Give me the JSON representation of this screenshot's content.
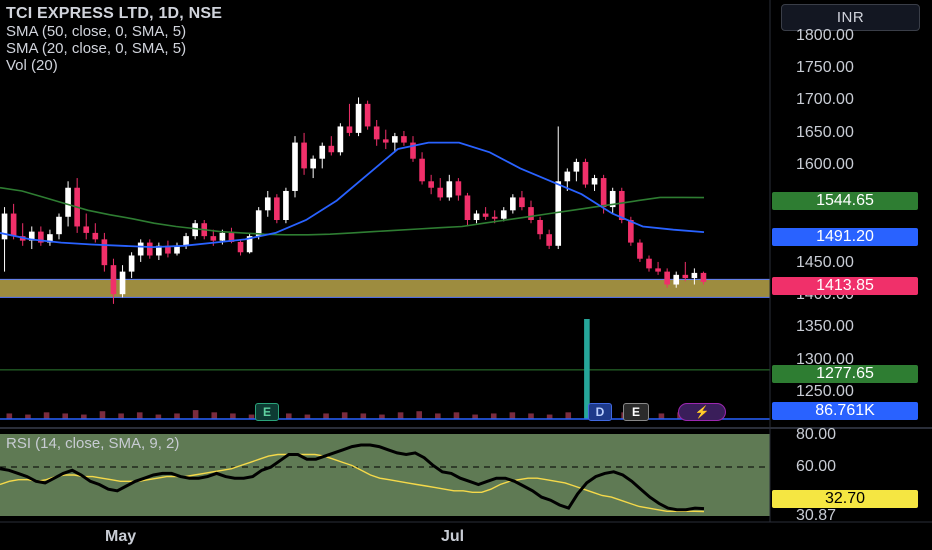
{
  "header": {
    "title": "TCI EXPRESS LTD, 1D, NSE",
    "indicator1": "SMA (50, close, 0, SMA, 5)",
    "indicator2": "SMA (20, close, 0, SMA, 5)",
    "indicator3": "Vol (20)"
  },
  "currency_button": "INR",
  "price_axis_ticks": [
    "1800.00",
    "1750.00",
    "1700.00",
    "1650.00",
    "1600.00",
    "1450.00",
    "1400.00",
    "1350.00",
    "1300.00",
    "1250.00"
  ],
  "badges": {
    "sma50": "1544.65",
    "sma20": "1491.20",
    "last_price": "1413.85",
    "hline": "1277.65",
    "volume": "86.761K"
  },
  "rsi": {
    "label": "RSI (14, close, SMA, 9, 2)",
    "ticks": [
      "80.00",
      "60.00"
    ],
    "rsi_value": "32.70",
    "rsi_ma_value": "30.87"
  },
  "time_axis": [
    "May",
    "Jul"
  ],
  "events": {
    "earnings1": "E",
    "dividend": "D",
    "earnings2": "E",
    "flash": "⚡"
  },
  "colors": {
    "up": "#ffffff",
    "down": "#f0306a",
    "sma50": "#2e7d32",
    "sma20": "#2962ff",
    "support_zone": "#b9a44a",
    "rsi_bg": "#5f7a54",
    "rsi_ma": "#f5d94a"
  },
  "chart_data": {
    "type": "candlestick",
    "ylim": [
      1200,
      1820
    ],
    "support_zone": [
      1390,
      1418
    ],
    "horizontal_line": 1277.65,
    "candles": [
      {
        "o": 1480,
        "h": 1530,
        "l": 1430,
        "c": 1520
      },
      {
        "o": 1520,
        "h": 1535,
        "l": 1480,
        "c": 1485
      },
      {
        "o": 1485,
        "h": 1505,
        "l": 1470,
        "c": 1478
      },
      {
        "o": 1478,
        "h": 1500,
        "l": 1465,
        "c": 1492
      },
      {
        "o": 1492,
        "h": 1500,
        "l": 1470,
        "c": 1475
      },
      {
        "o": 1475,
        "h": 1495,
        "l": 1470,
        "c": 1488
      },
      {
        "o": 1488,
        "h": 1520,
        "l": 1480,
        "c": 1515
      },
      {
        "o": 1515,
        "h": 1570,
        "l": 1500,
        "c": 1560
      },
      {
        "o": 1560,
        "h": 1575,
        "l": 1490,
        "c": 1500
      },
      {
        "o": 1500,
        "h": 1520,
        "l": 1480,
        "c": 1490
      },
      {
        "o": 1490,
        "h": 1505,
        "l": 1475,
        "c": 1480
      },
      {
        "o": 1480,
        "h": 1490,
        "l": 1430,
        "c": 1440
      },
      {
        "o": 1440,
        "h": 1450,
        "l": 1380,
        "c": 1395
      },
      {
        "o": 1395,
        "h": 1440,
        "l": 1390,
        "c": 1430
      },
      {
        "o": 1430,
        "h": 1460,
        "l": 1420,
        "c": 1455
      },
      {
        "o": 1455,
        "h": 1480,
        "l": 1445,
        "c": 1475
      },
      {
        "o": 1475,
        "h": 1480,
        "l": 1450,
        "c": 1455
      },
      {
        "o": 1455,
        "h": 1475,
        "l": 1448,
        "c": 1470
      },
      {
        "o": 1470,
        "h": 1478,
        "l": 1452,
        "c": 1458
      },
      {
        "o": 1458,
        "h": 1475,
        "l": 1455,
        "c": 1470
      },
      {
        "o": 1470,
        "h": 1490,
        "l": 1465,
        "c": 1485
      },
      {
        "o": 1485,
        "h": 1510,
        "l": 1480,
        "c": 1505
      },
      {
        "o": 1505,
        "h": 1510,
        "l": 1480,
        "c": 1485
      },
      {
        "o": 1485,
        "h": 1495,
        "l": 1470,
        "c": 1478
      },
      {
        "o": 1478,
        "h": 1495,
        "l": 1472,
        "c": 1490
      },
      {
        "o": 1490,
        "h": 1498,
        "l": 1474,
        "c": 1476
      },
      {
        "o": 1476,
        "h": 1480,
        "l": 1455,
        "c": 1460
      },
      {
        "o": 1460,
        "h": 1490,
        "l": 1458,
        "c": 1485
      },
      {
        "o": 1485,
        "h": 1530,
        "l": 1480,
        "c": 1525
      },
      {
        "o": 1525,
        "h": 1555,
        "l": 1515,
        "c": 1545
      },
      {
        "o": 1545,
        "h": 1550,
        "l": 1505,
        "c": 1510
      },
      {
        "o": 1510,
        "h": 1560,
        "l": 1505,
        "c": 1555
      },
      {
        "o": 1555,
        "h": 1640,
        "l": 1545,
        "c": 1630
      },
      {
        "o": 1630,
        "h": 1645,
        "l": 1580,
        "c": 1590
      },
      {
        "o": 1590,
        "h": 1610,
        "l": 1575,
        "c": 1605
      },
      {
        "o": 1605,
        "h": 1630,
        "l": 1590,
        "c": 1625
      },
      {
        "o": 1625,
        "h": 1640,
        "l": 1610,
        "c": 1615
      },
      {
        "o": 1615,
        "h": 1660,
        "l": 1610,
        "c": 1655
      },
      {
        "o": 1655,
        "h": 1690,
        "l": 1640,
        "c": 1645
      },
      {
        "o": 1645,
        "h": 1700,
        "l": 1640,
        "c": 1690
      },
      {
        "o": 1690,
        "h": 1695,
        "l": 1650,
        "c": 1655
      },
      {
        "o": 1655,
        "h": 1665,
        "l": 1625,
        "c": 1635
      },
      {
        "o": 1635,
        "h": 1650,
        "l": 1620,
        "c": 1630
      },
      {
        "o": 1630,
        "h": 1645,
        "l": 1615,
        "c": 1640
      },
      {
        "o": 1640,
        "h": 1648,
        "l": 1625,
        "c": 1630
      },
      {
        "o": 1630,
        "h": 1640,
        "l": 1600,
        "c": 1605
      },
      {
        "o": 1605,
        "h": 1615,
        "l": 1565,
        "c": 1570
      },
      {
        "o": 1570,
        "h": 1580,
        "l": 1550,
        "c": 1560
      },
      {
        "o": 1560,
        "h": 1575,
        "l": 1540,
        "c": 1545
      },
      {
        "o": 1545,
        "h": 1580,
        "l": 1540,
        "c": 1570
      },
      {
        "o": 1570,
        "h": 1575,
        "l": 1540,
        "c": 1548
      },
      {
        "o": 1548,
        "h": 1552,
        "l": 1500,
        "c": 1510
      },
      {
        "o": 1510,
        "h": 1525,
        "l": 1505,
        "c": 1520
      },
      {
        "o": 1520,
        "h": 1530,
        "l": 1510,
        "c": 1515
      },
      {
        "o": 1515,
        "h": 1525,
        "l": 1505,
        "c": 1512
      },
      {
        "o": 1512,
        "h": 1530,
        "l": 1508,
        "c": 1525
      },
      {
        "o": 1525,
        "h": 1550,
        "l": 1520,
        "c": 1545
      },
      {
        "o": 1545,
        "h": 1555,
        "l": 1525,
        "c": 1530
      },
      {
        "o": 1530,
        "h": 1540,
        "l": 1505,
        "c": 1510
      },
      {
        "o": 1510,
        "h": 1515,
        "l": 1480,
        "c": 1488
      },
      {
        "o": 1488,
        "h": 1495,
        "l": 1465,
        "c": 1470
      },
      {
        "o": 1470,
        "h": 1655,
        "l": 1465,
        "c": 1570
      },
      {
        "o": 1570,
        "h": 1590,
        "l": 1555,
        "c": 1585
      },
      {
        "o": 1585,
        "h": 1605,
        "l": 1570,
        "c": 1600
      },
      {
        "o": 1600,
        "h": 1605,
        "l": 1560,
        "c": 1565
      },
      {
        "o": 1565,
        "h": 1580,
        "l": 1555,
        "c": 1575
      },
      {
        "o": 1575,
        "h": 1580,
        "l": 1520,
        "c": 1530
      },
      {
        "o": 1530,
        "h": 1560,
        "l": 1520,
        "c": 1555
      },
      {
        "o": 1555,
        "h": 1560,
        "l": 1505,
        "c": 1510
      },
      {
        "o": 1510,
        "h": 1515,
        "l": 1470,
        "c": 1475
      },
      {
        "o": 1475,
        "h": 1480,
        "l": 1445,
        "c": 1450
      },
      {
        "o": 1450,
        "h": 1455,
        "l": 1430,
        "c": 1435
      },
      {
        "o": 1435,
        "h": 1445,
        "l": 1425,
        "c": 1430
      },
      {
        "o": 1430,
        "h": 1435,
        "l": 1405,
        "c": 1410
      },
      {
        "o": 1410,
        "h": 1430,
        "l": 1405,
        "c": 1425
      },
      {
        "o": 1425,
        "h": 1445,
        "l": 1415,
        "c": 1420
      },
      {
        "o": 1420,
        "h": 1435,
        "l": 1410,
        "c": 1428
      },
      {
        "o": 1428,
        "h": 1430,
        "l": 1410,
        "c": 1414
      }
    ],
    "sma50": [
      1560,
      1555,
      1545,
      1535,
      1525,
      1518,
      1512,
      1505,
      1500,
      1496,
      1492,
      1490,
      1488,
      1487,
      1487,
      1488,
      1490,
      1492,
      1494,
      1496,
      1498,
      1500,
      1505,
      1510,
      1515,
      1520,
      1525,
      1530,
      1535,
      1540,
      1545,
      1545,
      1544.65
    ],
    "sma20": [
      1490,
      1480,
      1475,
      1472,
      1470,
      1468,
      1470,
      1475,
      1480,
      1490,
      1510,
      1540,
      1580,
      1620,
      1630,
      1630,
      1615,
      1590,
      1570,
      1550,
      1520,
      1500,
      1495,
      1491.2
    ],
    "volume": [
      5,
      4,
      6,
      5,
      4,
      7,
      5,
      6,
      4,
      5,
      8,
      6,
      5,
      4,
      6,
      5,
      4,
      5,
      6,
      5,
      4,
      6,
      7,
      5,
      6,
      4,
      5,
      6,
      5,
      4,
      6,
      90,
      5,
      6,
      4,
      5,
      6,
      5
    ],
    "rsi_series": [
      58,
      57,
      55,
      53,
      50,
      49,
      52,
      55,
      57,
      54,
      50,
      48,
      45,
      44,
      47,
      50,
      52,
      54,
      55,
      55,
      53,
      52,
      52,
      53,
      55,
      53,
      52,
      52,
      53,
      57,
      59,
      63,
      67,
      67,
      64,
      64,
      66,
      68,
      70,
      72,
      73,
      73,
      72,
      70,
      68,
      67,
      68,
      65,
      60,
      56,
      55,
      52,
      50,
      48,
      50,
      52,
      52,
      50,
      47,
      44,
      40,
      38,
      35,
      33,
      42,
      49,
      53,
      55,
      56,
      54,
      50,
      45,
      40,
      36,
      33,
      32,
      32,
      33,
      32.7
    ],
    "rsi_ma_series": [
      48,
      50,
      51,
      51,
      50,
      51,
      53,
      54,
      54,
      53,
      53,
      52,
      51,
      50,
      50,
      50,
      51,
      52,
      53,
      53,
      53,
      54,
      55,
      56,
      57,
      58,
      60,
      62,
      64,
      66,
      67,
      67,
      67,
      67,
      67,
      66,
      64,
      62,
      60,
      57,
      54,
      52,
      51,
      50,
      49,
      48,
      47,
      46,
      45,
      44,
      44,
      43,
      43,
      45,
      48,
      50,
      51,
      52,
      52,
      51,
      50,
      49,
      47,
      45,
      43,
      41,
      40,
      38,
      36,
      34,
      33,
      32,
      31,
      31,
      31,
      31,
      30.87
    ]
  }
}
